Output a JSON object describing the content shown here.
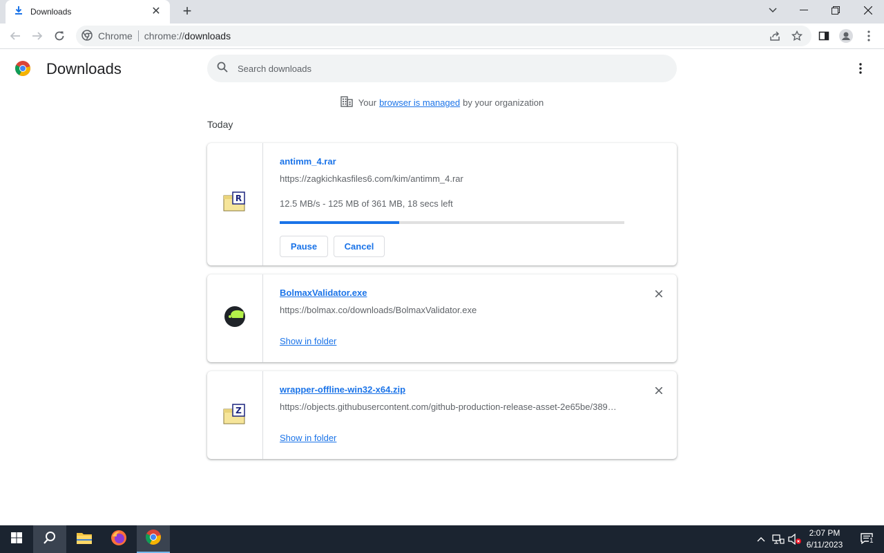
{
  "browser": {
    "tab_title": "Downloads",
    "omnibox_chip": "Chrome",
    "url_scheme": "chrome://",
    "url_host": "downloads"
  },
  "page": {
    "title": "Downloads",
    "search_placeholder": "Search downloads",
    "managed_prefix": "Your",
    "managed_link": "browser is managed",
    "managed_suffix": "by your organization",
    "section_label": "Today"
  },
  "downloads": [
    {
      "file_name": "antimm_4.rar",
      "url": "https://zagkichkasfiles6.com/kim/antimm_4.rar",
      "status": "12.5 MB/s - 125 MB of 361 MB, 18 secs left",
      "progress_fraction": 0.346,
      "pause_label": "Pause",
      "cancel_label": "Cancel",
      "icon": "rar-file-icon",
      "badge_letter": "R"
    },
    {
      "file_name": "BolmaxValidator.exe",
      "url": "https://bolmax.co/downloads/BolmaxValidator.exe",
      "action_label": "Show in folder",
      "icon": "bolmax-app-icon"
    },
    {
      "file_name": "wrapper-offline-win32-x64.zip",
      "url": "https://objects.githubusercontent.com/github-production-release-asset-2e65be/389…",
      "action_label": "Show in folder",
      "icon": "zip-file-icon",
      "badge_letter": "Z"
    }
  ],
  "taskbar": {
    "time": "2:07 PM",
    "date": "6/11/2023",
    "notification_count": "1"
  },
  "colors": {
    "accent": "#1a73e8",
    "taskbar_bg": "#1b2430"
  }
}
